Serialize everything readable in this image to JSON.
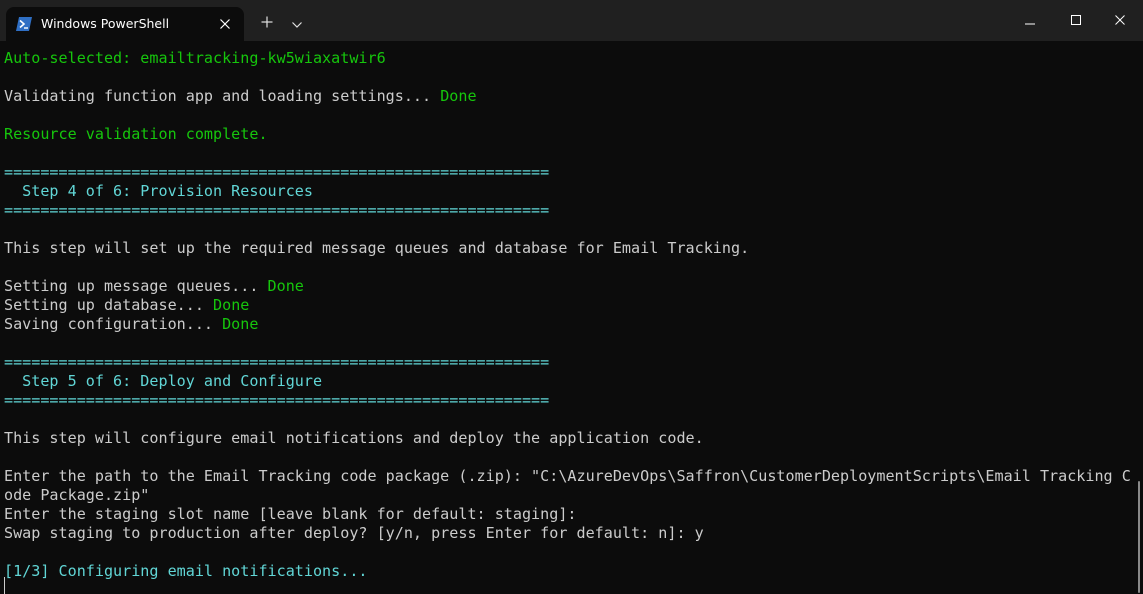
{
  "window": {
    "tab_title": "Windows PowerShell",
    "new_tab_symbol": "+",
    "icons": {
      "tab": "powershell-icon",
      "close_tab": "close-icon",
      "new_tab": "plus-icon",
      "dropdown": "chevron-down-icon",
      "minimize": "minimize-icon",
      "maximize": "maximize-icon",
      "close_window": "close-icon"
    }
  },
  "colors": {
    "background": "#0c0c0c",
    "titlebar": "#202020",
    "text": "#cccccc",
    "green": "#16c60c",
    "cyan": "#61d6d6"
  },
  "terminal": {
    "line_01": "Auto-selected: emailtracking-kw5wiaxatwir6",
    "line_02_text": "Validating function app and loading settings... ",
    "line_02_status": "Done",
    "line_03": "Resource validation complete.",
    "line_04": "============================================================",
    "line_05": "  Step 4 of 6: Provision Resources",
    "line_06": "============================================================",
    "line_07": "This step will set up the required message queues and database for Email Tracking.",
    "line_08_text": "Setting up message queues... ",
    "line_08_status": "Done",
    "line_09_text": "Setting up database... ",
    "line_09_status": "Done",
    "line_10_text": "Saving configuration... ",
    "line_10_status": "Done",
    "line_11": "============================================================",
    "line_12": "  Step 5 of 6: Deploy and Configure",
    "line_13": "============================================================",
    "line_14": "This step will configure email notifications and deploy the application code.",
    "line_15": "Enter the path to the Email Tracking code package (.zip): \"C:\\AzureDevOps\\Saffron\\CustomerDeploymentScripts\\Email Tracking C",
    "line_16": "ode Package.zip\"",
    "line_17": "Enter the staging slot name [leave blank for default: staging]:",
    "line_18": "Swap staging to production after deploy? [y/n, press Enter for default: n]: y",
    "line_19": "[1/3] Configuring email notifications..."
  }
}
